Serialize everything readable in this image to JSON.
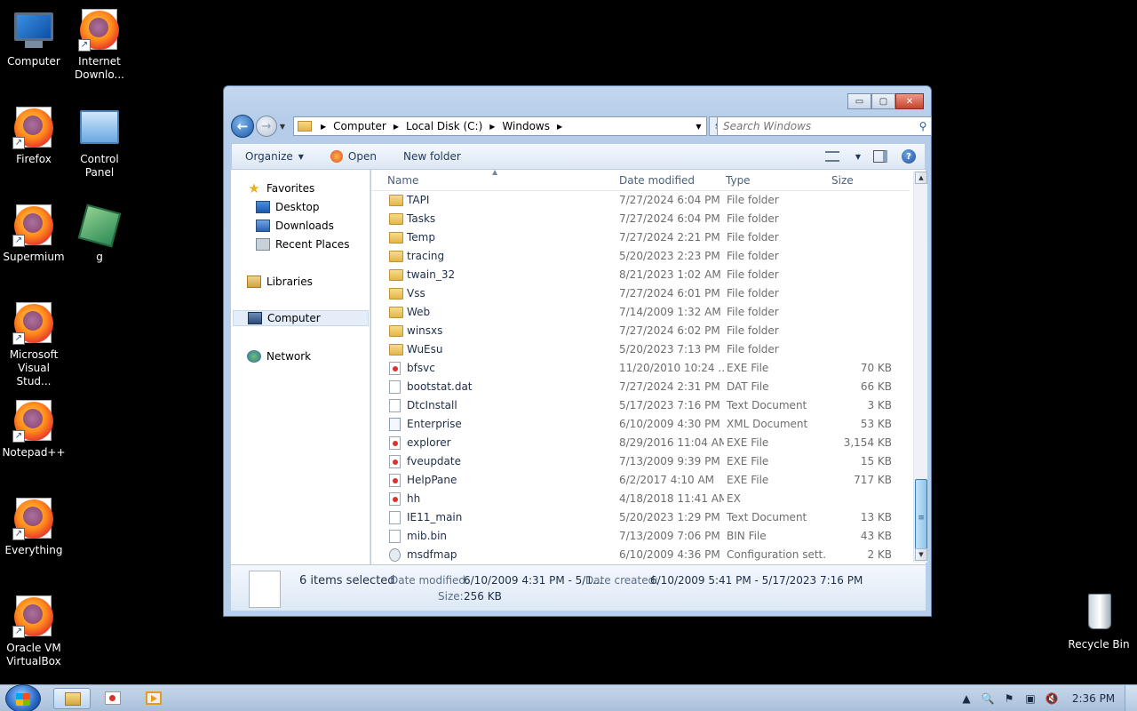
{
  "desktop": {
    "icons": [
      {
        "label": "Computer",
        "icon": "computer-icon"
      },
      {
        "label": "Internet Downlo...",
        "icon": "firefox-icon"
      },
      {
        "label": "Firefox",
        "icon": "firefox-icon"
      },
      {
        "label": "Control Panel",
        "icon": "control-panel-icon"
      },
      {
        "label": "Supermium",
        "icon": "firefox-icon"
      },
      {
        "label": "g",
        "icon": "registry-icon"
      },
      {
        "label": "Microsoft Visual Stud...",
        "icon": "firefox-icon"
      },
      {
        "label": "Notepad++",
        "icon": "firefox-icon"
      },
      {
        "label": "Everything",
        "icon": "firefox-icon"
      },
      {
        "label": "Oracle VM VirtualBox",
        "icon": "firefox-icon"
      },
      {
        "label": "Recycle Bin",
        "icon": "recycle-bin-icon"
      }
    ]
  },
  "window": {
    "controls": {
      "minimize": "▭",
      "maximize": "▢",
      "close": "✕"
    },
    "breadcrumb": [
      "Computer",
      "Local Disk (C:)",
      "Windows"
    ],
    "search_placeholder": "Search Windows",
    "toolbar": {
      "organize": "Organize",
      "open": "Open",
      "new_folder": "New folder"
    },
    "nav": {
      "favorites": "Favorites",
      "desktop": "Desktop",
      "downloads": "Downloads",
      "recent": "Recent Places",
      "libraries": "Libraries",
      "computer": "Computer",
      "network": "Network"
    },
    "columns": {
      "name": "Name",
      "date": "Date modified",
      "type": "Type",
      "size": "Size"
    },
    "files": [
      {
        "name": "TAPI",
        "date": "7/27/2024 6:04 PM",
        "type": "File folder",
        "size": "",
        "kind": "folder"
      },
      {
        "name": "Tasks",
        "date": "7/27/2024 6:04 PM",
        "type": "File folder",
        "size": "",
        "kind": "folder"
      },
      {
        "name": "Temp",
        "date": "7/27/2024 2:21 PM",
        "type": "File folder",
        "size": "",
        "kind": "folder"
      },
      {
        "name": "tracing",
        "date": "5/20/2023 2:23 PM",
        "type": "File folder",
        "size": "",
        "kind": "folder"
      },
      {
        "name": "twain_32",
        "date": "8/21/2023 1:02 AM",
        "type": "File folder",
        "size": "",
        "kind": "folder"
      },
      {
        "name": "Vss",
        "date": "7/27/2024 6:01 PM",
        "type": "File folder",
        "size": "",
        "kind": "folder"
      },
      {
        "name": "Web",
        "date": "7/14/2009 1:32 AM",
        "type": "File folder",
        "size": "",
        "kind": "folder"
      },
      {
        "name": "winsxs",
        "date": "7/27/2024 6:02 PM",
        "type": "File folder",
        "size": "",
        "kind": "folder"
      },
      {
        "name": "WuEsu",
        "date": "5/20/2023 7:13 PM",
        "type": "File folder",
        "size": "",
        "kind": "folder"
      },
      {
        "name": "bfsvc",
        "date": "11/20/2010 10:24 ...",
        "type": "EXE File",
        "size": "70 KB",
        "kind": "exe"
      },
      {
        "name": "bootstat.dat",
        "date": "7/27/2024 2:31 PM",
        "type": "DAT File",
        "size": "66 KB",
        "kind": "file"
      },
      {
        "name": "DtcInstall",
        "date": "5/17/2023 7:16 PM",
        "type": "Text Document",
        "size": "3 KB",
        "kind": "file"
      },
      {
        "name": "Enterprise",
        "date": "6/10/2009 4:30 PM",
        "type": "XML Document",
        "size": "53 KB",
        "kind": "xml"
      },
      {
        "name": "explorer",
        "date": "8/29/2016 11:04 AM",
        "type": "EXE File",
        "size": "3,154 KB",
        "kind": "exe"
      },
      {
        "name": "fveupdate",
        "date": "7/13/2009 9:39 PM",
        "type": "EXE File",
        "size": "15 KB",
        "kind": "exe"
      },
      {
        "name": "HelpPane",
        "date": "6/2/2017 4:10 AM",
        "type": "EXE File",
        "size": "717 KB",
        "kind": "exe"
      },
      {
        "name": "hh",
        "date": "4/18/2018 11:41 AM",
        "type": "EX",
        "size": "",
        "kind": "exe"
      },
      {
        "name": "IE11_main",
        "date": "5/20/2023 1:29 PM",
        "type": "Text Document",
        "size": "13 KB",
        "kind": "file"
      },
      {
        "name": "mib.bin",
        "date": "7/13/2009 7:06 PM",
        "type": "BIN File",
        "size": "43 KB",
        "kind": "file"
      },
      {
        "name": "msdfmap",
        "date": "6/10/2009 4:36 PM",
        "type": "Configuration sett...",
        "size": "2 KB",
        "kind": "cfg"
      }
    ],
    "tooltip": "fveupdate",
    "details": {
      "selected": "6 items selected",
      "date_modified_label": "Date modified:",
      "date_modified": "6/10/2009 4:31 PM - 5/1...",
      "date_created_label": "Date created:",
      "date_created": "6/10/2009 5:41 PM - 5/17/2023 7:16 PM",
      "size_label": "Size:",
      "size": "256 KB"
    }
  },
  "taskbar": {
    "clock": "2:36 PM",
    "tray": [
      "▲",
      "🔍",
      "⚑",
      "▣",
      "🔇"
    ]
  }
}
